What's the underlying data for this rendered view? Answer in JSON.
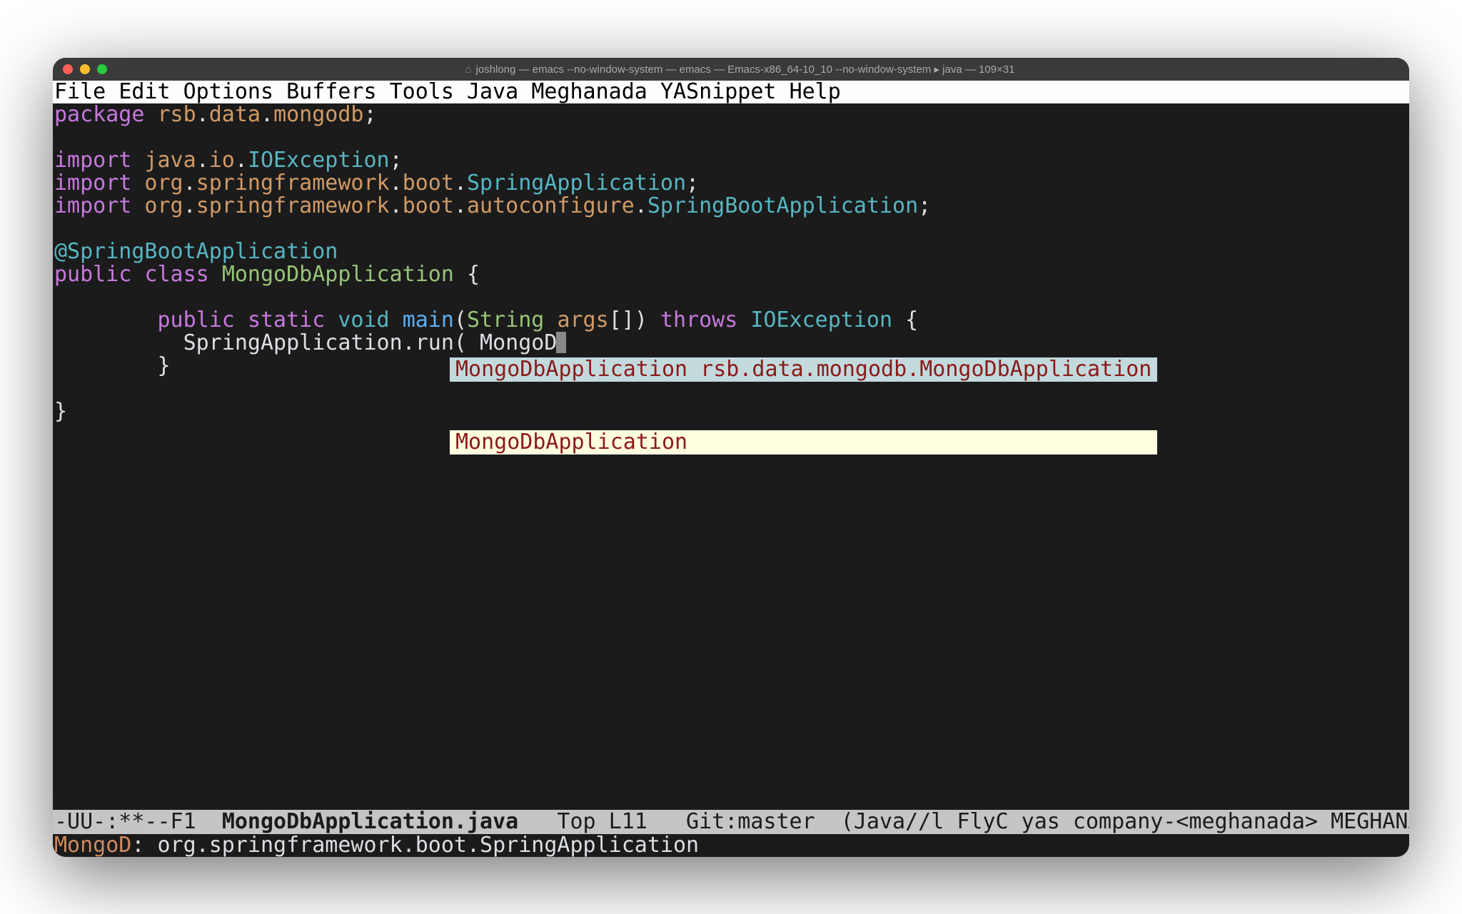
{
  "titlebar": {
    "home_glyph": "⌂",
    "text": "joshlong — emacs --no-window-system — emacs — Emacs-x86_64-10_10 --no-window-system ▸ java — 109×31"
  },
  "menubar": {
    "items": [
      "File",
      "Edit",
      "Options",
      "Buffers",
      "Tools",
      "Java",
      "Meghanada",
      "YASnippet",
      "Help"
    ]
  },
  "code": {
    "l1_package_kw": "package",
    "l1_pkg1": " rsb",
    "l1_dot1": ".",
    "l1_pkg2": "data",
    "l1_dot2": ".",
    "l1_pkg3": "mongodb",
    "l1_semi": ";",
    "imp_kw": "import",
    "i1_p1": " java",
    "dot": ".",
    "i1_p2": "io",
    "i1_p3": "IOException",
    "semi": ";",
    "i2_p1": " org",
    "i2_p2": "springframework",
    "i2_p3": "boot",
    "i2_p4": "SpringApplication",
    "i3_p1": " org",
    "i3_p2": "springframework",
    "i3_p3": "boot",
    "i3_p4": "autoconfigure",
    "i3_p5": "SpringBootApplication",
    "annot": "@SpringBootApplication",
    "public_kw": "public",
    "class_kw": "class",
    "class_name": "MongoDbApplication",
    "obrace": " {",
    "indent2": "        ",
    "static_kw": "static",
    "void_kw": "void",
    "main_name": "main",
    "lp": "(",
    "string_type": "String",
    "args_name": "args",
    "brackets": "[]",
    "rp": ")",
    "throws_kw": "throws",
    "ioexc": "IOException",
    "indent2b": "          ",
    "call_obj": "SpringApplication",
    "call_dot": ".",
    "call_run": "run",
    "call_lp": "(",
    "call_arg_partial": " MongoD",
    "indent2c": "        ",
    "cbrace_inner": "}",
    "cbrace_outer": "}",
    "blank": ""
  },
  "completion": {
    "selected": "MongoDbApplication rsb.data.mongodb.MongoDbApplication",
    "item2": "MongoDbApplication                                    "
  },
  "modeline": {
    "left": "-UU-:**--F1  ",
    "filename": "MongoDbApplication.java",
    "rest": "   Top L11   Git:master  (Java//l FlyC yas company-<meghanada> MEGHANADA "
  },
  "minibuffer": {
    "key": "MongoD",
    "sep": ": ",
    "value": "org.springframework.boot.SpringApplication"
  }
}
